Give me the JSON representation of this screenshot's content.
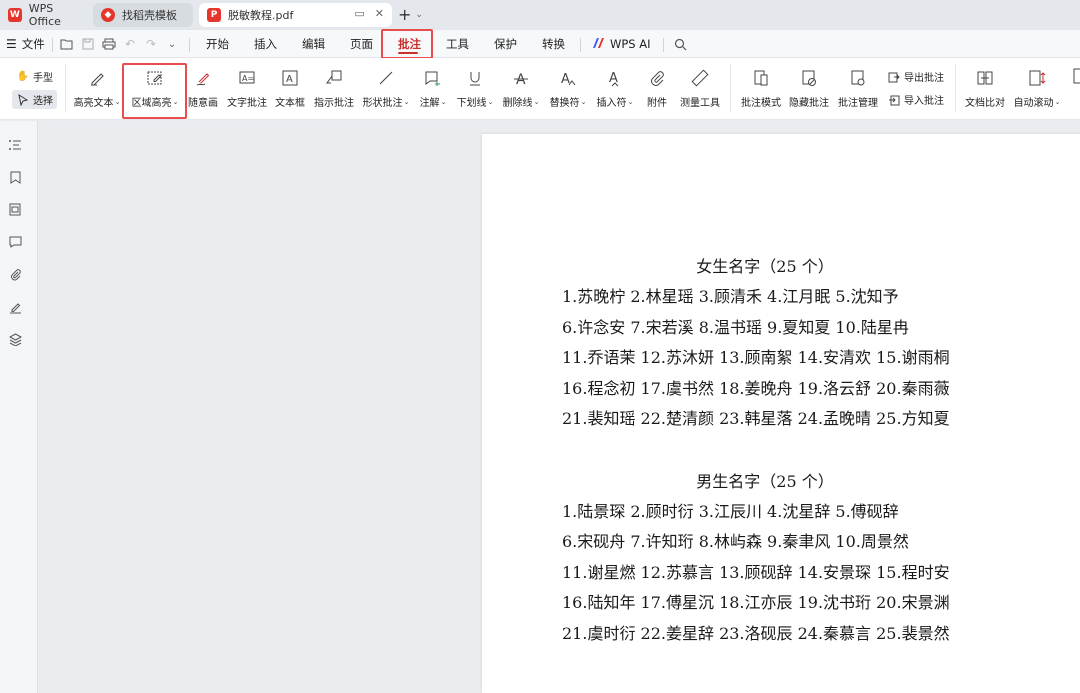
{
  "titlebar": {
    "app_tab": "WPS Office",
    "template_tab": "找稻壳模板",
    "doc_tab": "脱敏教程.pdf"
  },
  "menubar": {
    "file_label": "文件",
    "tabs": [
      "开始",
      "插入",
      "编辑",
      "页面",
      "批注",
      "工具",
      "保护",
      "转换"
    ],
    "active_tab": "批注",
    "ai_label": "WPS AI"
  },
  "ribbon": {
    "hand_tool": "手型",
    "select_tool": "选择",
    "tools": [
      {
        "label": "高亮文本",
        "dropdown": true
      },
      {
        "label": "区域高亮",
        "dropdown": true
      },
      {
        "label": "随意画",
        "dropdown": false
      },
      {
        "label": "文字批注",
        "dropdown": false
      },
      {
        "label": "文本框",
        "dropdown": false
      },
      {
        "label": "指示批注",
        "dropdown": false
      },
      {
        "label": "形状批注",
        "dropdown": true
      },
      {
        "label": "注解",
        "dropdown": true
      },
      {
        "label": "下划线",
        "dropdown": true
      },
      {
        "label": "删除线",
        "dropdown": true
      },
      {
        "label": "替换符",
        "dropdown": true
      },
      {
        "label": "插入符",
        "dropdown": true
      },
      {
        "label": "附件",
        "dropdown": false
      },
      {
        "label": "测量工具",
        "dropdown": false
      }
    ],
    "tools2": [
      {
        "label": "批注模式",
        "dropdown": false
      },
      {
        "label": "隐藏批注",
        "dropdown": false
      },
      {
        "label": "批注管理",
        "dropdown": false
      }
    ],
    "export_label": "导出批注",
    "import_label": "导入批注",
    "tools3": [
      {
        "label": "文档比对",
        "dropdown": false
      },
      {
        "label": "自动滚动",
        "dropdown": true
      }
    ]
  },
  "document": {
    "sections": [
      {
        "title": "女生名字（25 个）",
        "lines": [
          "1.苏晚柠 2.林星瑶 3.顾清禾 4.江月眠 5.沈知予",
          "6.许念安 7.宋若溪 8.温书瑶 9.夏知夏 10.陆星冉",
          "11.乔语茉 12.苏沐妍 13.顾南絮 14.安清欢 15.谢雨桐",
          "16.程念初 17.虞书然 18.姜晚舟 19.洛云舒 20.秦雨薇",
          "21.裴知瑶 22.楚清颜 23.韩星落 24.孟晚晴 25.方知夏"
        ]
      },
      {
        "title": "男生名字（25 个）",
        "lines": [
          "1.陆景琛 2.顾时衍 3.江辰川 4.沈星辞 5.傅砚辞",
          "6.宋砚舟 7.许知珩 8.林屿森 9.秦聿风 10.周景然",
          "11.谢星燃 12.苏慕言 13.顾砚辞 14.安景琛 15.程时安",
          "16.陆知年 17.傅星沉 18.江亦辰 19.沈书珩 20.宋景渊",
          "21.虞时衍 22.姜星辞 23.洛砚辰 24.秦慕言 25.裴景然"
        ]
      }
    ]
  },
  "colors": {
    "highlight_box": "#e84c4c",
    "active_tab": "#c9302c",
    "wps_red": "#e5352c"
  }
}
